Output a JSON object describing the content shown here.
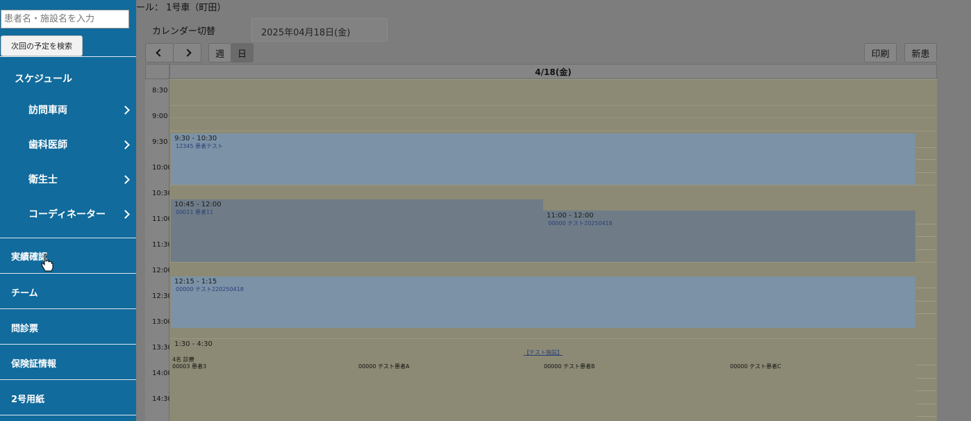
{
  "sidebar": {
    "search_placeholder": "患者名・施設名を入力",
    "search_button": "次回の予定を検索",
    "schedule_heading": "スケジュール",
    "sub_items": [
      "訪問車両",
      "歯科医師",
      "衛生士",
      "コーディネーター"
    ],
    "items": [
      "実績確認",
      "チーム",
      "問診票",
      "保険証情報",
      "2号用紙"
    ]
  },
  "header": {
    "title_fragment": "ール： 1号車（町田）",
    "calendar_switch_label": "カレンダー切替",
    "date_value": "2025年04月18日(金)"
  },
  "toolbar": {
    "prev": "<",
    "next": ">",
    "week": "週",
    "day": "日",
    "print": "印刷",
    "new_patient": "新患"
  },
  "calendar": {
    "day_header": "4/18(金)",
    "time_labels": [
      "8:30",
      "9:00",
      "9:30",
      "10:00",
      "10:30",
      "11:00",
      "11:30",
      "12:00",
      "12:30",
      "13:00",
      "13:30",
      "14:00",
      "14:30"
    ],
    "events": [
      {
        "time": "9:30 - 10:30",
        "patient": "12345 患者テスト"
      },
      {
        "time": "10:45 - 12:00",
        "patient": "00011 患者11"
      },
      {
        "time": "11:00 - 12:00",
        "patient": "00000 テスト20250418"
      },
      {
        "time": "12:15 - 1:15",
        "patient": "00000 テスト220250418"
      },
      {
        "time": "1:30 - 4:30",
        "facility": "【テスト施設】",
        "count": "4名 診療",
        "patients": [
          "00003 患者3",
          "00000 テスト患者A",
          "00000 テスト患者B",
          "00000 テスト患者C"
        ]
      }
    ]
  },
  "colors": {
    "sidebar_bg": "#116b9c",
    "event_bg": "#7c92a6",
    "slot_bg": "#8c8a74"
  }
}
